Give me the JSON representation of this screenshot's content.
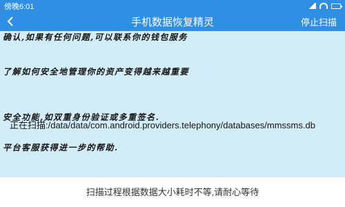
{
  "status_bar": {
    "time": "傍晚6:01"
  },
  "app_bar": {
    "title": "手机数据恢复精灵",
    "stop_label": "停止扫描"
  },
  "background_text": {
    "line1": "确认,如果有任何问题,可以联系你的钱包服务",
    "line2": "了解如何安全地管理你的资产变得越来越重要",
    "line3": "安全功能,如双重身份验证或多重签名.",
    "line4": "平台客服获得进一步的帮助."
  },
  "scan": {
    "path_text": "正在扫描:/data/data/com.android.providers.telephony/databases/mmssms.db"
  },
  "footer": {
    "notice": "扫描过程根据数据大小耗时不等,请耐心等待"
  },
  "colors": {
    "accent": "#2f8fe5",
    "content_background": "#d2ecf8"
  }
}
